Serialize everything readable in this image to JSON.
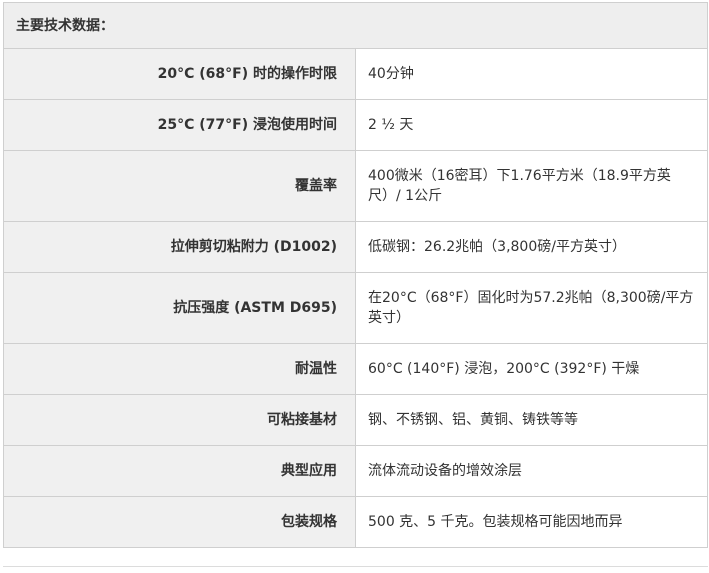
{
  "table": {
    "header": "主要技术数据：",
    "rows": [
      {
        "label": "20°C (68°F) 时的操作时限",
        "value": "40分钟"
      },
      {
        "label": "25°C (77°F) 浸泡使用时间",
        "value": "2 ½ 天"
      },
      {
        "label": "覆盖率",
        "value": "400微米（16密耳）下1.76平方米（18.9平方英尺）/ 1公斤"
      },
      {
        "label": "拉伸剪切粘附力 (D1002)",
        "value": "低碳钢：26.2兆帕（3,800磅/平方英寸）"
      },
      {
        "label": "抗压强度 (ASTM D695)",
        "value": "在20°C（68°F）固化时为57.2兆帕（8,300磅/平方英寸）"
      },
      {
        "label": "耐温性",
        "value": "60°C (140°F) 浸泡，200°C (392°F) 干燥"
      },
      {
        "label": "可粘接基材",
        "value": "钢、不锈钢、铝、黄铜、铸铁等等"
      },
      {
        "label": "典型应用",
        "value": "流体流动设备的增效涂层"
      },
      {
        "label": "包装规格",
        "value": "500 克、5 千克。包装规格可能因地而异"
      }
    ]
  }
}
